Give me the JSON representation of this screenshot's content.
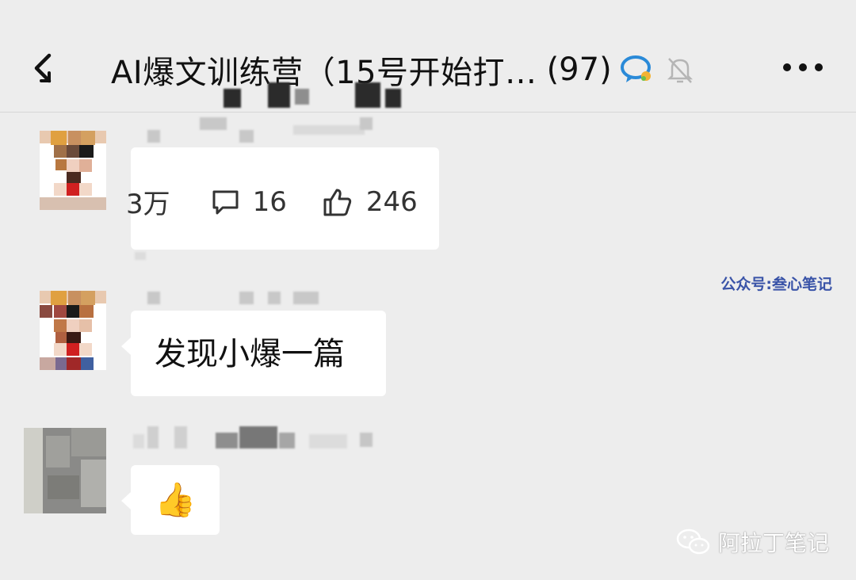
{
  "header": {
    "title": "AI爆文训练营（15号开始打…",
    "member_count": "(97)",
    "icons": [
      "back-arrow-icon",
      "chat-bubble-icon",
      "muted-bell-icon",
      "more-dots-icon"
    ]
  },
  "messages": [
    {
      "type": "article-card-stats",
      "views": "3万",
      "comments": "16",
      "likes": "246",
      "icons": [
        "comment-icon",
        "thumbs-up-icon"
      ]
    },
    {
      "type": "text",
      "text": "发现小爆一篇"
    },
    {
      "type": "emoji",
      "emoji": "👍"
    }
  ],
  "watermarks": {
    "official_account": "公众号:叁心笔记",
    "wechat_account": "阿拉丁笔记"
  },
  "colors": {
    "background": "#ededed",
    "bubble": "#ffffff",
    "watermark_blue": "#3a54a8"
  }
}
